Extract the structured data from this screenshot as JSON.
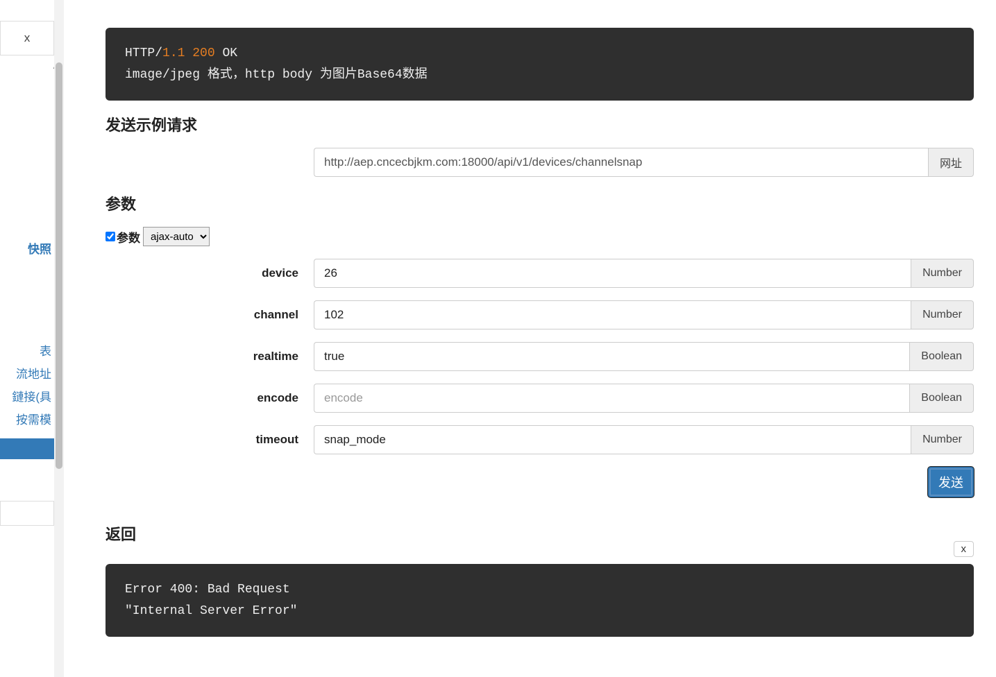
{
  "sidebar": {
    "top_close": "x",
    "links": {
      "active": "快照",
      "l1": "表",
      "l2": "流地址",
      "l3": "鏈接(具",
      "l4": "按需模"
    }
  },
  "codeblock": {
    "line1_pre": "HTTP/",
    "line1_mid": "1.1 200",
    "line1_post": " OK",
    "line2": "image/jpeg 格式，http body 为图片Base64数据"
  },
  "headings": {
    "sample_request": "发送示例请求",
    "params": "参数",
    "response": "返回"
  },
  "url": {
    "value": "http://aep.cncecbjkm.com:18000/api/v1/devices/channelsnap",
    "addon": "网址"
  },
  "param_controls": {
    "checkbox_label": "参数",
    "select_value": "ajax-auto"
  },
  "params": [
    {
      "name": "device",
      "value": "26",
      "placeholder": "",
      "type": "Number"
    },
    {
      "name": "channel",
      "value": "102",
      "placeholder": "",
      "type": "Number"
    },
    {
      "name": "realtime",
      "value": "true",
      "placeholder": "",
      "type": "Boolean"
    },
    {
      "name": "encode",
      "value": "",
      "placeholder": "encode",
      "type": "Boolean"
    },
    {
      "name": "timeout",
      "value": "snap_mode",
      "placeholder": "",
      "type": "Number"
    }
  ],
  "buttons": {
    "send": "发送",
    "close_x": "x"
  },
  "response": {
    "line1": "Error 400: Bad Request",
    "line2": "\"Internal Server Error\""
  }
}
